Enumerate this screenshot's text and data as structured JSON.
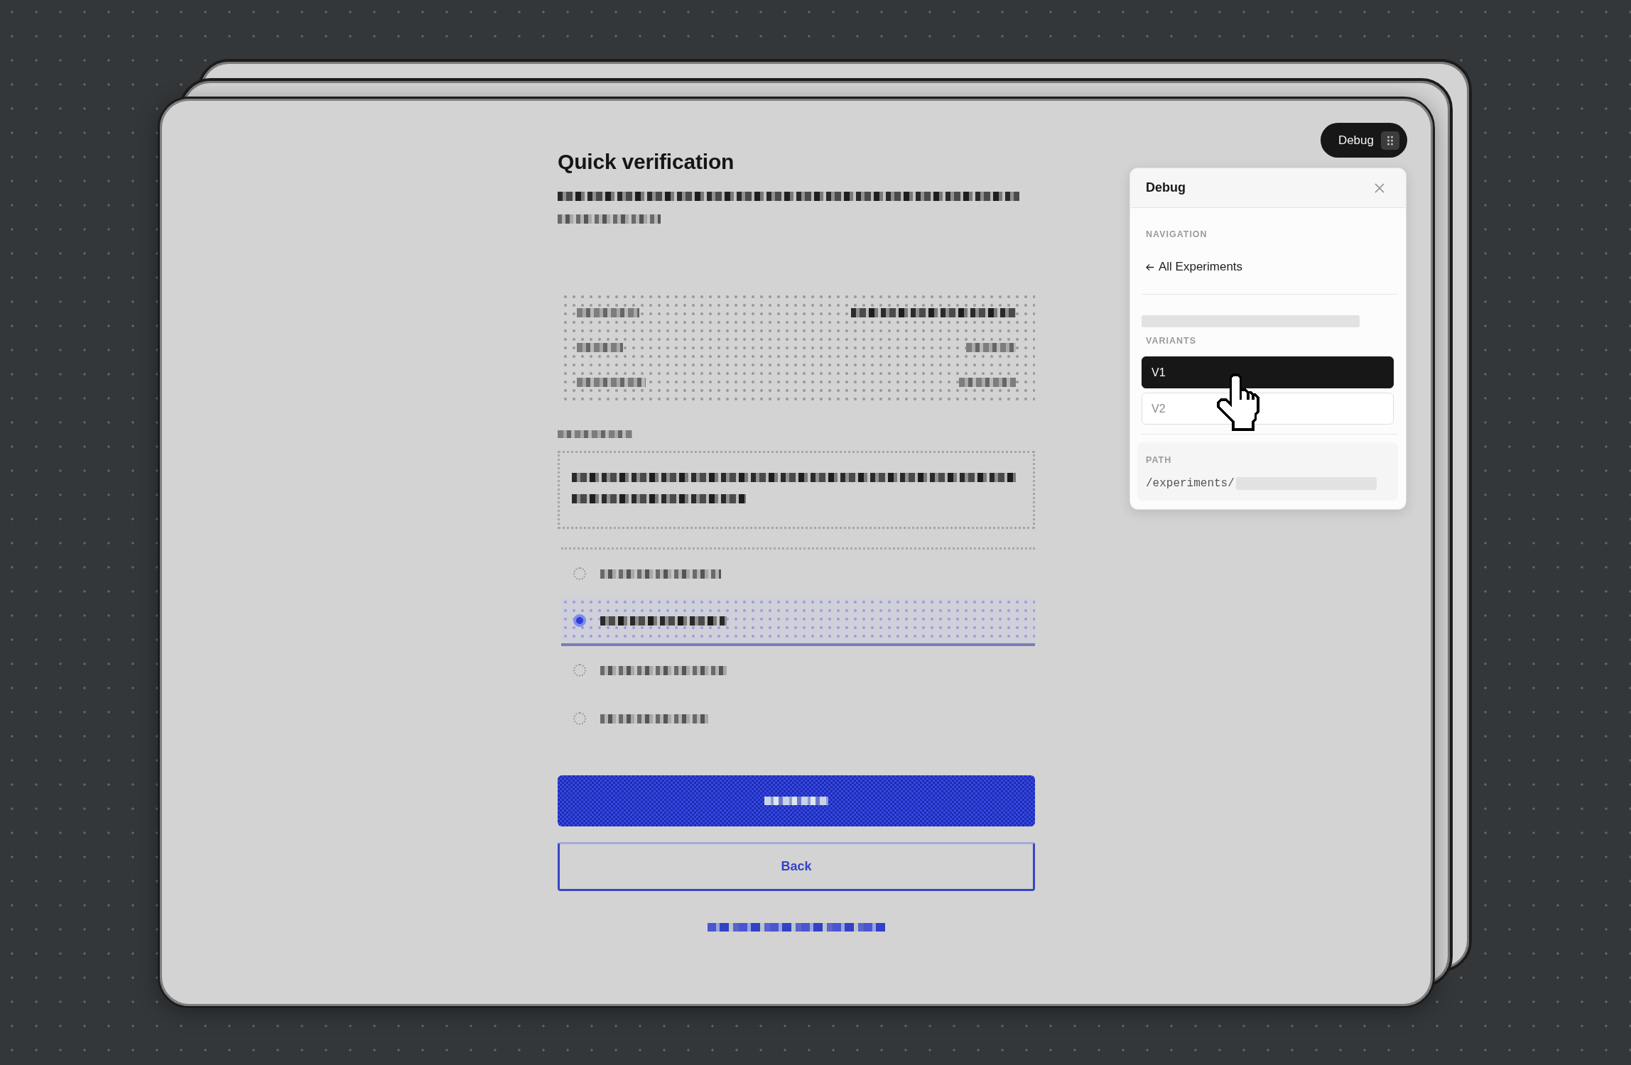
{
  "page": {
    "title": "Quick verification",
    "options": [
      {
        "selected": false
      },
      {
        "selected": true
      },
      {
        "selected": false
      },
      {
        "selected": false
      }
    ],
    "secondary_button": {
      "label": "Back"
    }
  },
  "debug_toggle": {
    "label": "Debug"
  },
  "debug_panel": {
    "title": "Debug",
    "navigation": {
      "heading": "NAVIGATION",
      "link": "All Experiments"
    },
    "variants": {
      "heading": "VARIANTS",
      "items": [
        {
          "label": "V1",
          "selected": true
        },
        {
          "label": "V2",
          "selected": false
        }
      ]
    },
    "path": {
      "heading": "PATH",
      "value": "/experiments/"
    }
  }
}
